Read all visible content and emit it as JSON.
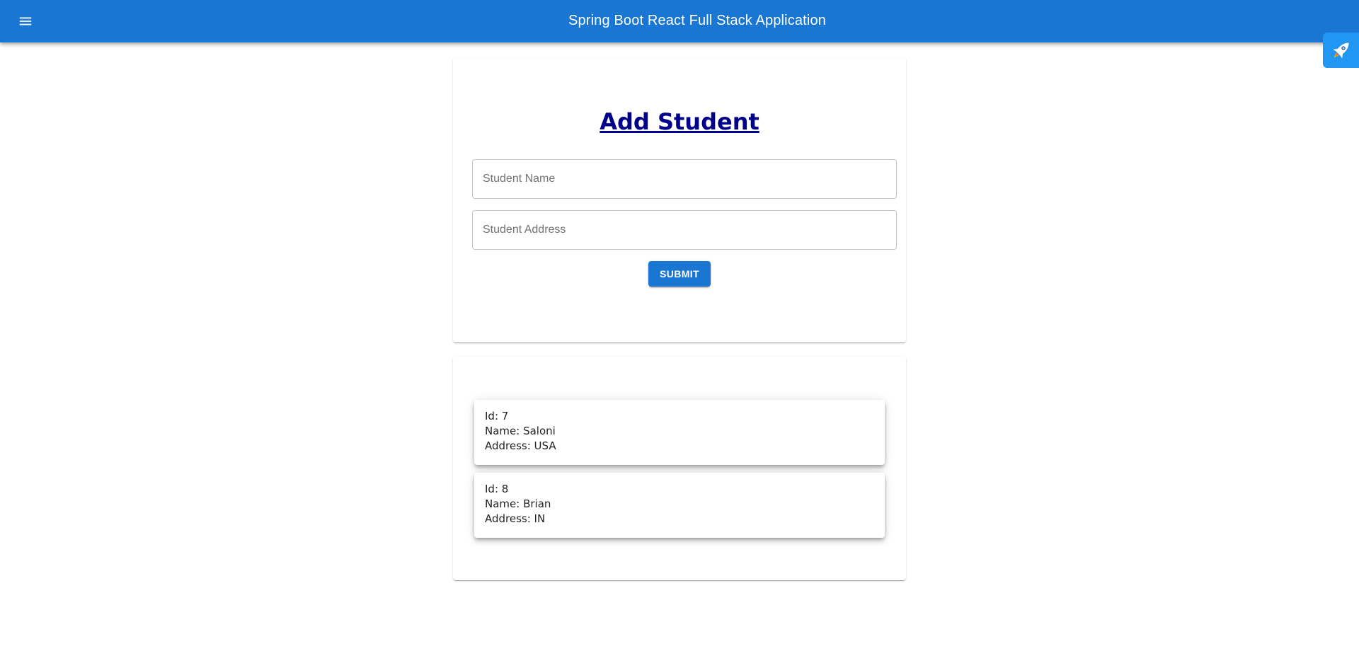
{
  "appbar": {
    "title": "Spring Boot React Full Stack Application",
    "menu_icon": "menu-icon",
    "background": "#1976d2"
  },
  "floating_widget": {
    "icon": "rocket-icon",
    "background": "#2196f3"
  },
  "form": {
    "heading": "Add Student",
    "heading_color": "#00008b",
    "name_field": {
      "placeholder": "Student Name",
      "value": ""
    },
    "address_field": {
      "placeholder": "Student Address",
      "value": ""
    },
    "submit_label": "Submit"
  },
  "students": [
    {
      "id": "Id: 7",
      "name": "Name: Saloni",
      "address": "Address: USA"
    },
    {
      "id": "Id: 8",
      "name": "Name: Brian",
      "address": "Address: IN"
    }
  ]
}
